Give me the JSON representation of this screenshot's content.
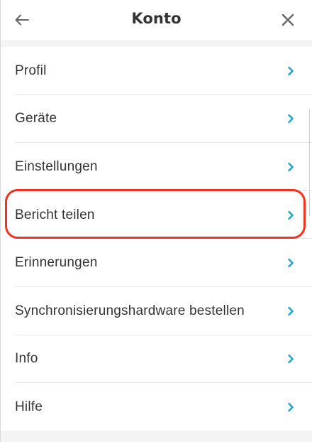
{
  "header": {
    "title": "Konto",
    "back_icon": "arrow-left-icon",
    "close_icon": "close-icon"
  },
  "menu": {
    "items": [
      {
        "label": "Profil"
      },
      {
        "label": "Geräte"
      },
      {
        "label": "Einstellungen"
      },
      {
        "label": "Bericht teilen",
        "highlighted": true
      },
      {
        "label": "Erinnerungen"
      },
      {
        "label": "Synchronisierungshardware bestellen"
      },
      {
        "label": "Info"
      },
      {
        "label": "Hilfe"
      }
    ],
    "chevron_icon": "chevron-right-icon"
  },
  "colors": {
    "chevron": "#1aa6c4",
    "highlight": "#f0321e",
    "text": "#333333",
    "icon": "#666666"
  }
}
